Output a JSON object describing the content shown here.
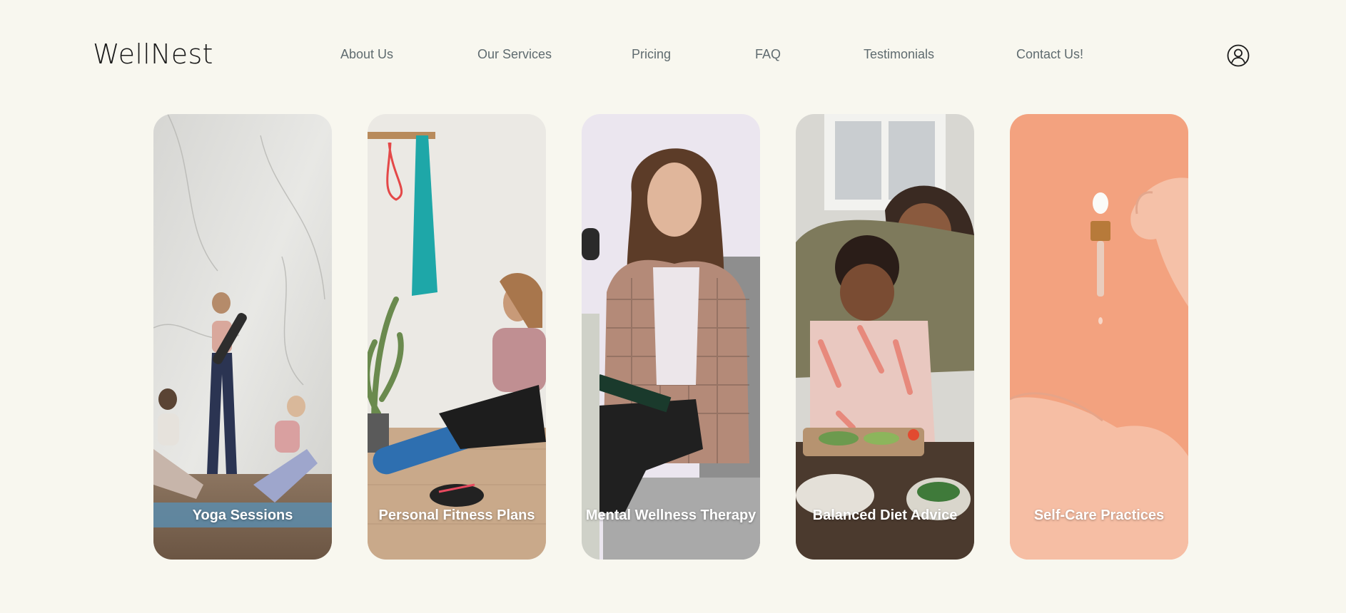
{
  "header": {
    "logo": "WellNest",
    "nav": [
      {
        "label": "About Us"
      },
      {
        "label": "Our Services"
      },
      {
        "label": "Pricing"
      },
      {
        "label": "FAQ"
      },
      {
        "label": "Testimonials"
      },
      {
        "label": "Contact Us!"
      }
    ],
    "account_icon": "user-circle-icon"
  },
  "services": [
    {
      "title": "Yoga Sessions",
      "image": "yoga-group-photo"
    },
    {
      "title": "Personal Fitness Plans",
      "image": "fitness-shoelace-photo"
    },
    {
      "title": "Mental Wellness Therapy",
      "image": "therapist-session-photo"
    },
    {
      "title": "Balanced Diet Advice",
      "image": "cooking-together-photo"
    },
    {
      "title": "Self-Care Practices",
      "image": "serum-dropper-photo"
    }
  ],
  "colors": {
    "page_background": "#f8f7ef",
    "nav_text": "#5f6b6f",
    "logo_text": "#1a1a1a",
    "selfcare_card": "#f3a27f"
  }
}
